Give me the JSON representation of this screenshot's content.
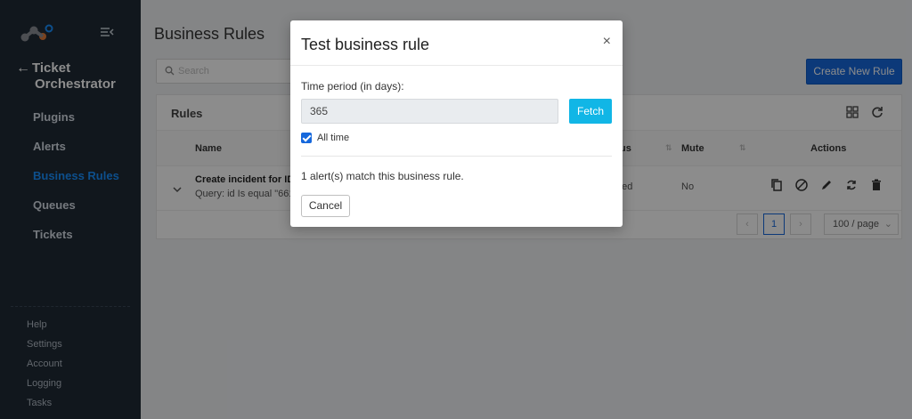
{
  "sidebar": {
    "back_title_line1": "Ticket",
    "back_title_line2": "Orchestrator",
    "items": [
      {
        "label": "Plugins"
      },
      {
        "label": "Alerts"
      },
      {
        "label": "Business Rules",
        "active": true
      },
      {
        "label": "Queues"
      },
      {
        "label": "Tickets"
      }
    ],
    "footer_items": [
      {
        "label": "Help"
      },
      {
        "label": "Settings"
      },
      {
        "label": "Account"
      },
      {
        "label": "Logging"
      },
      {
        "label": "Tasks"
      }
    ]
  },
  "header": {
    "title": "Business Rules",
    "search_placeholder": "Search",
    "create_label": "Create New Rule"
  },
  "card": {
    "title": "Rules",
    "columns": {
      "name": "Name",
      "status": "us",
      "mute": "Mute",
      "actions": "Actions"
    },
    "row": {
      "name": "Create incident for ID",
      "query": "Query: id Is equal \"661",
      "status": "ped",
      "mute": "No"
    },
    "pagination": {
      "current_page": "1",
      "page_size": "100 / page"
    }
  },
  "modal": {
    "title": "Test business rule",
    "close_glyph": "×",
    "field_label": "Time period (in days):",
    "days_value": "365",
    "fetch_label": "Fetch",
    "all_time_label": "All time",
    "all_time_checked": true,
    "match_text": "1 alert(s) match this business rule.",
    "cancel_label": "Cancel"
  },
  "colors": {
    "sidebar_bg": "#1f2a36",
    "active_nav": "#1890ff",
    "primary": "#1668dc",
    "fetch": "#11b6e6"
  }
}
